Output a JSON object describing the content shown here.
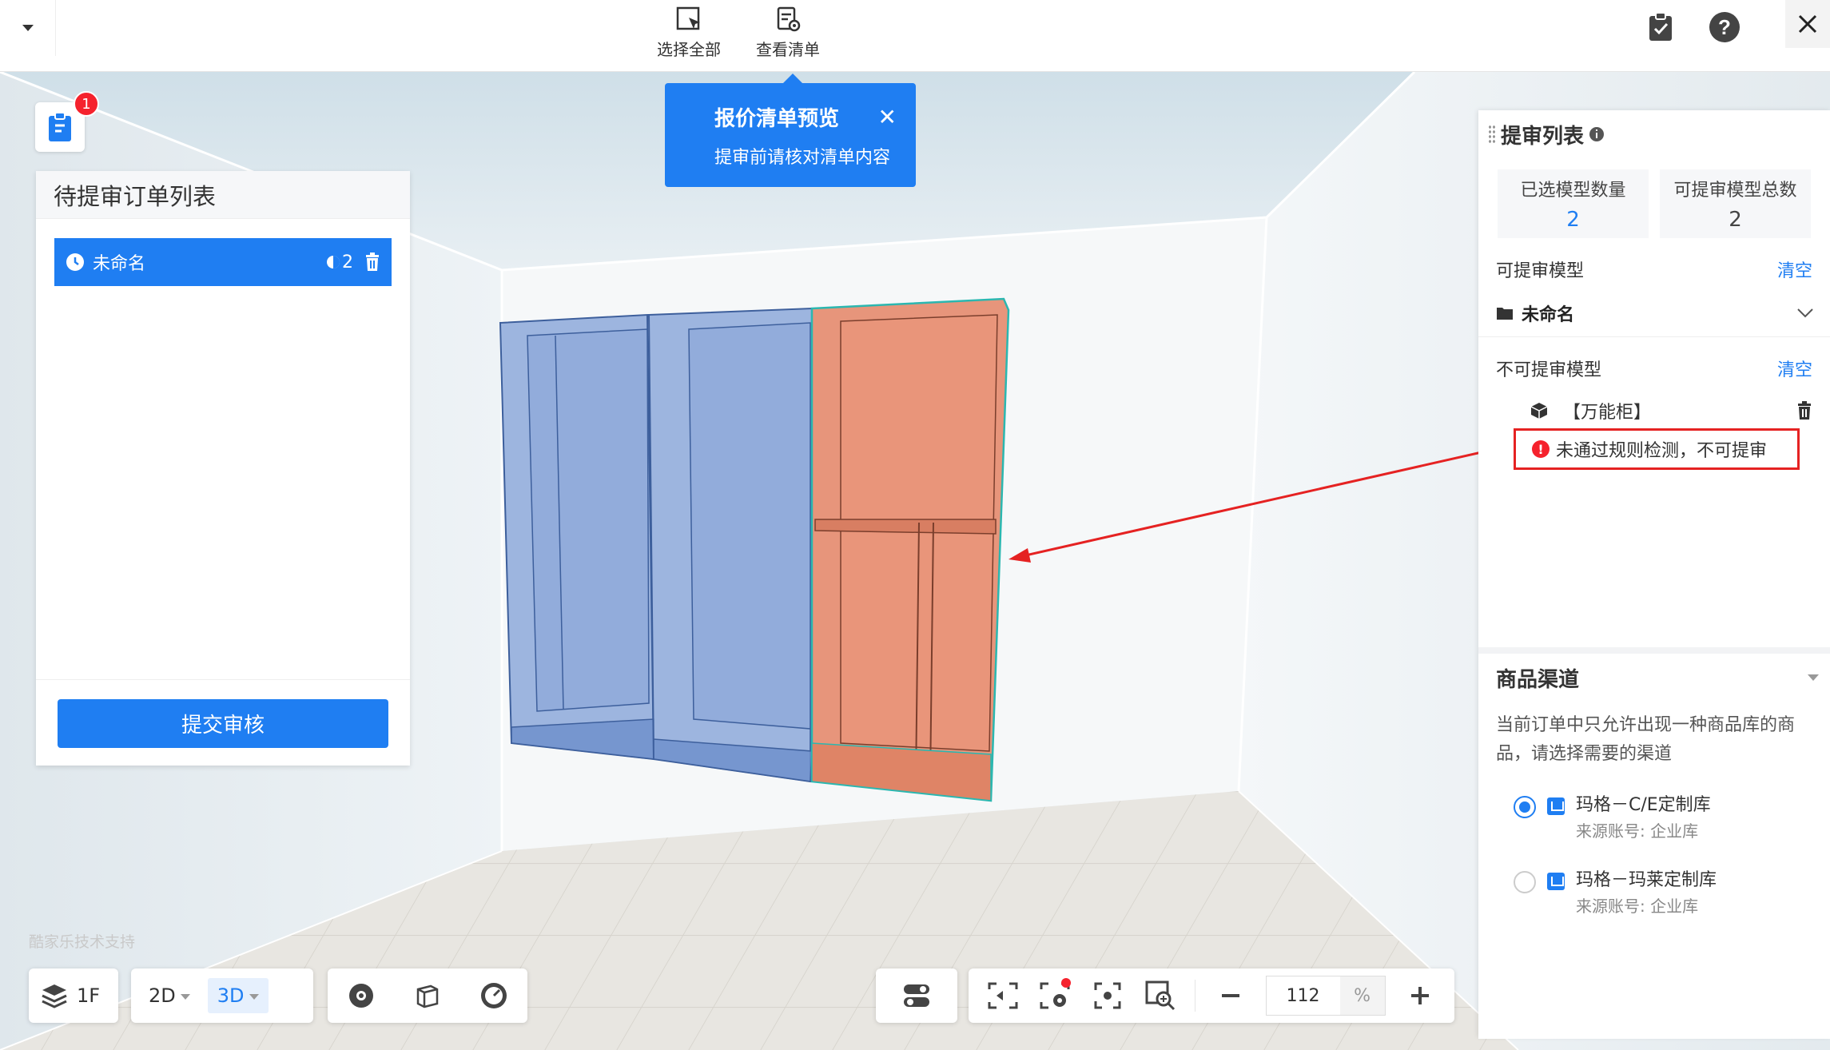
{
  "toolbar_top": {
    "select_all_label": "选择全部",
    "view_list_label": "查看清单"
  },
  "tooltip": {
    "title": "报价清单预览",
    "subtitle": "提审前请核对清单内容",
    "close": "✕"
  },
  "pending_orders": {
    "badge_count": "1",
    "title": "待提审订单列表",
    "items": [
      {
        "name": "未命名",
        "count": "2"
      }
    ],
    "submit_label": "提交审核"
  },
  "review_panel": {
    "title": "提审列表",
    "selected_label": "已选模型数量",
    "selected_value": "2",
    "total_label": "可提审模型总数",
    "total_value": "2",
    "submittable_label": "可提审模型",
    "clear_label": "清空",
    "folder_name": "未命名",
    "not_submittable_label": "不可提审模型",
    "clear_label_2": "清空",
    "model_name": "【万能柜】",
    "warning_text": "未通过规则检测，不可提审"
  },
  "channel": {
    "title": "商品渠道",
    "description": "当前订单中只允许出现一种商品库的商品，请选择需要的渠道",
    "options": [
      {
        "name": "玛格－C/E定制库",
        "source": "来源账号: 企业库",
        "selected": true
      },
      {
        "name": "玛格－玛莱定制库",
        "source": "来源账号: 企业库",
        "selected": false
      }
    ]
  },
  "bottom_toolbar": {
    "floor": "1F",
    "mode_2d": "2D",
    "mode_3d": "3D",
    "zoom": "112",
    "zoom_unit": "%"
  },
  "support_text": "酷家乐技术支持",
  "colors": {
    "accent": "#1f7ef2",
    "error": "#f5222d",
    "cabinet_blue": "#7f9fd6",
    "cabinet_orange": "#e58a6d"
  }
}
